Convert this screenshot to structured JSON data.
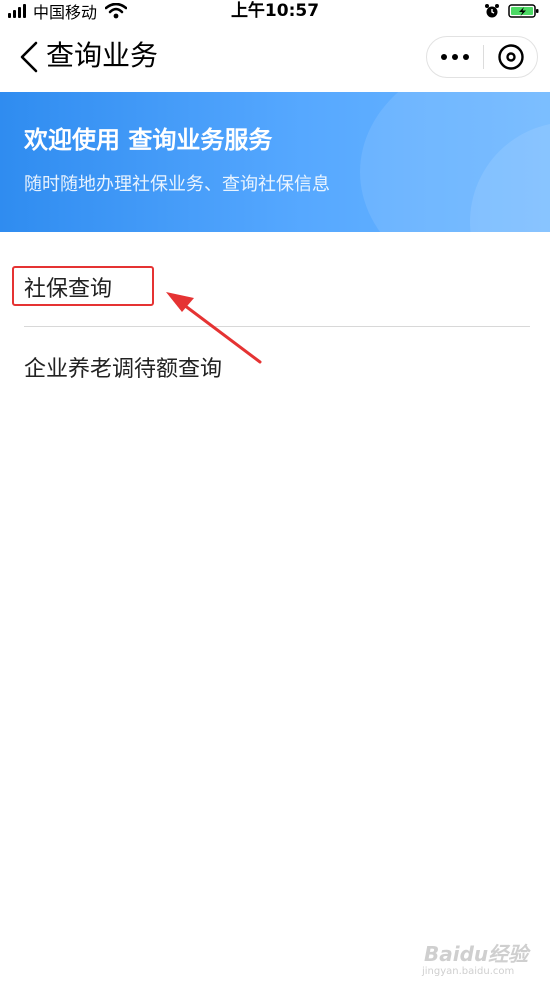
{
  "status_bar": {
    "carrier": "中国移动",
    "time": "上午10:57"
  },
  "nav": {
    "title": "查询业务",
    "icons": [
      "back-chevron-icon",
      "more-dots-icon",
      "close-circle-icon"
    ]
  },
  "banner": {
    "title": "欢迎使用 查询业务服务",
    "subtitle": "随时随地办理社保业务、查询社保信息",
    "colors": [
      "#2f8cf0",
      "#6db7ff"
    ]
  },
  "menu": {
    "items": [
      {
        "label": "社保查询"
      },
      {
        "label": "企业养老调待额查询"
      }
    ]
  },
  "annotation": {
    "highlight_color": "#e53333"
  },
  "watermark": {
    "text": "Baidu经验",
    "url": "jingyan.baidu.com"
  }
}
